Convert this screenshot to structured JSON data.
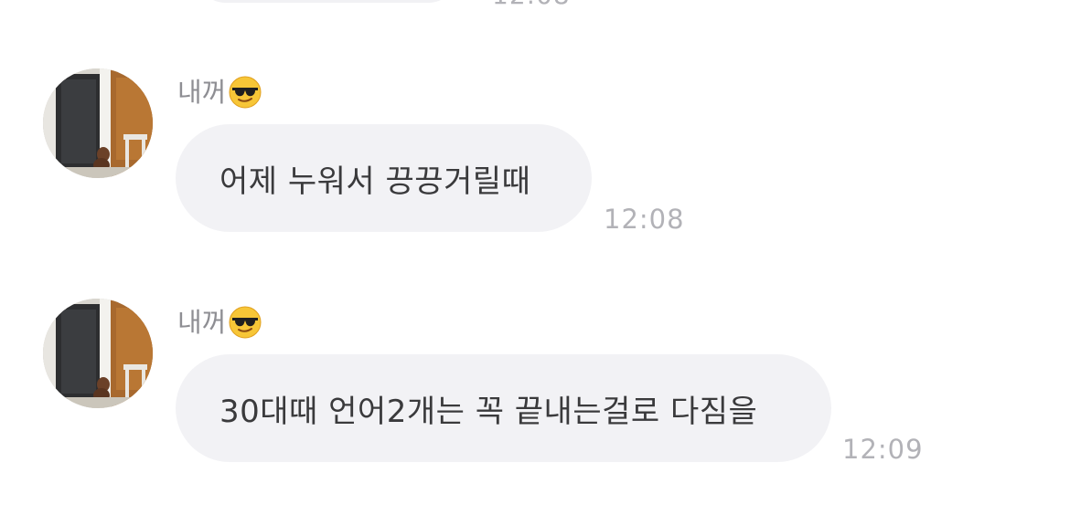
{
  "previous_message": {
    "time": "12:08"
  },
  "messages": [
    {
      "sender": "내꺼",
      "emoji": "😎",
      "text": "어제 누워서 끙끙거릴때",
      "time": "12:08"
    },
    {
      "sender": "내꺼",
      "emoji": "😎",
      "text": "30대때 언어2개는 꼭 끝내는걸로 다짐을",
      "time": "12:09"
    }
  ],
  "colors": {
    "bubble": "#f2f2f5",
    "text": "#3a3a3c",
    "sender": "#8e8e93",
    "time": "#b2b2b7"
  }
}
